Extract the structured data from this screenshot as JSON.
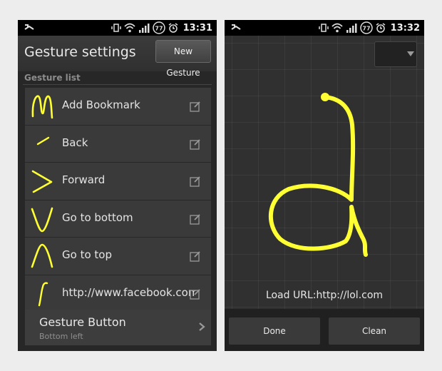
{
  "colors": {
    "gesture_stroke": "#ffff33",
    "accent": "#ffff33"
  },
  "left_screen": {
    "status_bar": {
      "time": "13:31",
      "battery": "77"
    },
    "title": "Gesture settings",
    "new_gesture_button": "New Gesture",
    "section_header": "Gesture list",
    "items": [
      {
        "label": "Add Bookmark",
        "icon": "gesture-m-icon"
      },
      {
        "label": "Back",
        "icon": "gesture-line-icon"
      },
      {
        "label": "Forward",
        "icon": "gesture-chevron-right-icon"
      },
      {
        "label": "Go to bottom",
        "icon": "gesture-v-icon"
      },
      {
        "label": "Go to top",
        "icon": "gesture-caret-icon"
      },
      {
        "label": "http://www.facebook.com",
        "icon": "gesture-s-curve-icon"
      }
    ],
    "gesture_button": {
      "title": "Gesture Button",
      "subtitle": "Bottom left"
    }
  },
  "right_screen": {
    "status_bar": {
      "time": "13:32",
      "battery": "77"
    },
    "load_url_text": "Load URL:http://lol.com",
    "done_button": "Done",
    "clean_button": "Clean"
  }
}
